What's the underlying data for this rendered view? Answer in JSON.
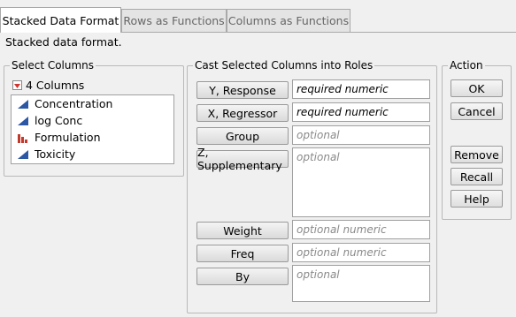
{
  "tabs": [
    {
      "label": "Stacked Data Format"
    },
    {
      "label": "Rows as Functions"
    },
    {
      "label": "Columns as Functions"
    }
  ],
  "description": "Stacked data format.",
  "select_columns": {
    "legend": "Select Columns",
    "count_label": "4 Columns",
    "items": [
      {
        "label": "Concentration",
        "icon": "continuous-icon"
      },
      {
        "label": "log Conc",
        "icon": "continuous-icon"
      },
      {
        "label": "Formulation",
        "icon": "nominal-icon"
      },
      {
        "label": "Toxicity",
        "icon": "continuous-icon"
      }
    ]
  },
  "roles": {
    "legend": "Cast Selected Columns into Roles",
    "items": [
      {
        "button": "Y, Response",
        "field": "required numeric"
      },
      {
        "button": "X, Regressor",
        "field": "required numeric"
      },
      {
        "button": "Group",
        "field": "optional"
      },
      {
        "button": "Z, Supplementary",
        "field": "optional"
      },
      {
        "button": "Weight",
        "field": "optional numeric"
      },
      {
        "button": "Freq",
        "field": "optional numeric"
      },
      {
        "button": "By",
        "field": "optional"
      }
    ]
  },
  "action": {
    "legend": "Action",
    "ok": "OK",
    "cancel": "Cancel",
    "remove": "Remove",
    "recall": "Recall",
    "help": "Help"
  },
  "colors": {
    "continuous": "#2b57a5",
    "nominal": "#c0392b",
    "dropdown_red": "#d0342c"
  }
}
